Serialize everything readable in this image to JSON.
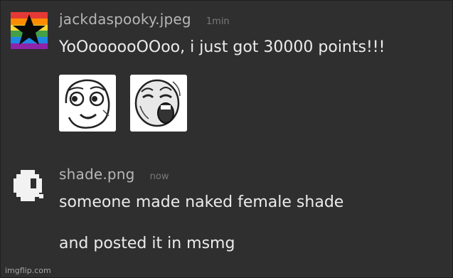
{
  "messages": [
    {
      "username": "jackdaspooky.jpeg",
      "timestamp": "1min",
      "avatar_icon": "rainbow-star-icon",
      "lines": [
        "YoOoooooOOoo, i just got 30000 points!!!"
      ],
      "emotes": [
        "derp-face-icon",
        "lol-face-icon"
      ]
    },
    {
      "username": "shade.png",
      "timestamp": "now",
      "avatar_icon": "shade-icon",
      "lines": [
        "someone made naked female shade",
        "and posted it in msmg"
      ]
    }
  ],
  "watermark": "imgflip.com",
  "colors": {
    "background": "#2f2f2f",
    "username": "#b7b7b7",
    "timestamp": "#7a7a7a",
    "text": "#ececec"
  }
}
